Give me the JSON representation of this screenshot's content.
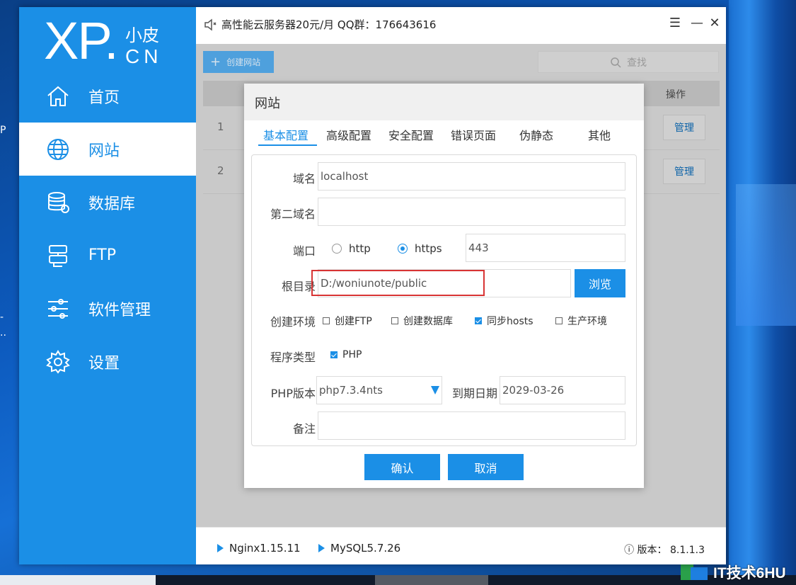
{
  "desktop": {
    "left_fragments": [
      "P",
      "-",
      ".."
    ],
    "watermark": "IT技术6HU"
  },
  "app": {
    "logo": {
      "main": "XP.",
      "sub_cn": "小皮",
      "sub_en": "CN"
    },
    "notice": "高性能云服务器20元/月  QQ群：176643616",
    "sidebar": {
      "items": [
        {
          "label": "首页",
          "icon": "home-icon"
        },
        {
          "label": "网站",
          "icon": "globe-icon",
          "active": true
        },
        {
          "label": "数据库",
          "icon": "database-icon"
        },
        {
          "label": "FTP",
          "icon": "server-icon"
        },
        {
          "label": "软件管理",
          "icon": "sliders-icon"
        },
        {
          "label": "设置",
          "icon": "gear-icon"
        }
      ]
    },
    "toolbar": {
      "create_label": "创建网站",
      "search_label": "查找"
    },
    "table": {
      "op_header": "操作",
      "rows": [
        {
          "num": "1",
          "action": "管理"
        },
        {
          "num": "2",
          "action": "管理"
        }
      ]
    },
    "status": {
      "nginx": "Nginx1.15.11",
      "mysql": "MySQL5.7.26",
      "version": "ⓘ 版本：  8.1.1.3"
    }
  },
  "dialog": {
    "title": "网站",
    "tabs": [
      "基本配置",
      "高级配置",
      "安全配置",
      "错误页面",
      "伪静态",
      "其他"
    ],
    "active_tab": "基本配置",
    "labels": {
      "domain": "域名",
      "second_domain": "第二域名",
      "port": "端口",
      "root": "根目录",
      "env": "创建环境",
      "program_type": "程序类型",
      "php_version": "PHP版本",
      "expire": "到期日期",
      "remark": "备注"
    },
    "values": {
      "domain": "localhost",
      "second_domain": "",
      "port": "443",
      "root": "D:/woniunote/public",
      "php_version": "php7.3.4nts",
      "expire": "2029-03-26",
      "remark": ""
    },
    "protocol_options": [
      {
        "label": "http",
        "selected": false
      },
      {
        "label": "https",
        "selected": true
      }
    ],
    "env_options": [
      {
        "label": "创建FTP",
        "checked": false
      },
      {
        "label": "创建数据库",
        "checked": false
      },
      {
        "label": "同步hosts",
        "checked": true
      },
      {
        "label": "生产环境",
        "checked": false
      }
    ],
    "program_options": [
      {
        "label": "PHP",
        "checked": true
      }
    ],
    "browse_label": "浏览",
    "confirm_label": "确认",
    "cancel_label": "取消"
  },
  "colors": {
    "accent": "#1b8fe6",
    "highlight": "#d83434"
  }
}
